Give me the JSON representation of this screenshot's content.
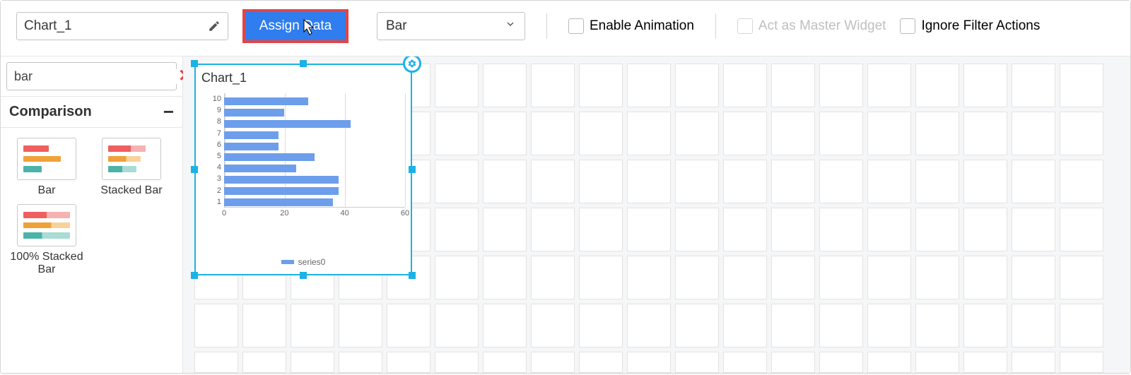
{
  "toolbar": {
    "chart_name": "Chart_1",
    "assign_label": "Assign Data",
    "chart_type": "Bar",
    "enable_animation_label": "Enable Animation",
    "master_widget_label": "Act as Master Widget",
    "ignore_filter_label": "Ignore Filter Actions"
  },
  "sidebar": {
    "search_value": "bar",
    "group_label": "Comparison",
    "thumbs": [
      {
        "label": "Bar"
      },
      {
        "label": "Stacked Bar"
      },
      {
        "label": "100% Stacked Bar"
      }
    ]
  },
  "widget": {
    "title": "Chart_1",
    "legend_label": "series0"
  },
  "chart_data": {
    "type": "bar",
    "orientation": "horizontal",
    "categories": [
      "1",
      "2",
      "3",
      "4",
      "5",
      "6",
      "7",
      "8",
      "9",
      "10"
    ],
    "values": [
      36,
      38,
      38,
      24,
      30,
      18,
      18,
      42,
      20,
      28
    ],
    "x_ticks": [
      0,
      20,
      40,
      60
    ],
    "xlim": [
      0,
      60
    ],
    "series_name": "series0"
  }
}
